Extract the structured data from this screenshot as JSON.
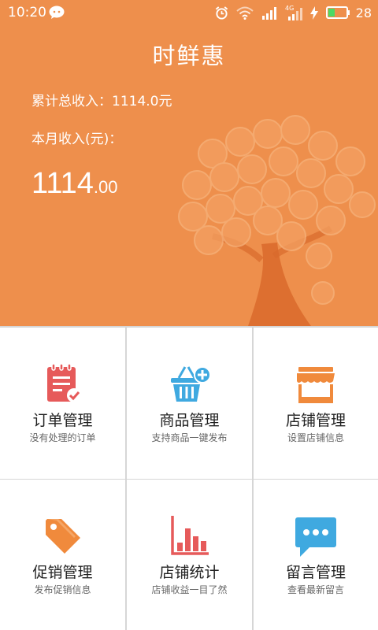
{
  "status_bar": {
    "time": "10:20",
    "network_type": "4G",
    "battery_level": "28",
    "icons": [
      "wechat-icon",
      "alarm-icon",
      "wifi-icon",
      "signal-icon",
      "signal-4g-icon",
      "charging-icon",
      "battery-icon"
    ]
  },
  "header": {
    "title": "时鲜惠",
    "total_income": "累计总收入：1114.0元",
    "month_label": "本月收入(元)：",
    "month_amount_int": "1114",
    "month_amount_dec": ".00"
  },
  "menu": [
    {
      "title": "订单管理",
      "subtitle": "没有处理的订单",
      "icon": "order-clipboard-icon",
      "color": "#e65a5a"
    },
    {
      "title": "商品管理",
      "subtitle": "支持商品一键发布",
      "icon": "basket-add-icon",
      "color": "#3fa9e0"
    },
    {
      "title": "店铺管理",
      "subtitle": "设置店铺信息",
      "icon": "storefront-icon",
      "color": "#f08a3c"
    },
    {
      "title": "促销管理",
      "subtitle": "发布促销信息",
      "icon": "price-tag-icon",
      "color": "#f08a3c"
    },
    {
      "title": "店铺统计",
      "subtitle": "店铺收益一目了然",
      "icon": "bar-chart-icon",
      "color": "#e65a5a"
    },
    {
      "title": "留言管理",
      "subtitle": "查看最新留言",
      "icon": "message-bubble-icon",
      "color": "#3fa9e0"
    }
  ],
  "colors": {
    "header_bg": "#ee8f4c",
    "tile_bg": "#ffffff",
    "divider": "#d6d6d6"
  }
}
